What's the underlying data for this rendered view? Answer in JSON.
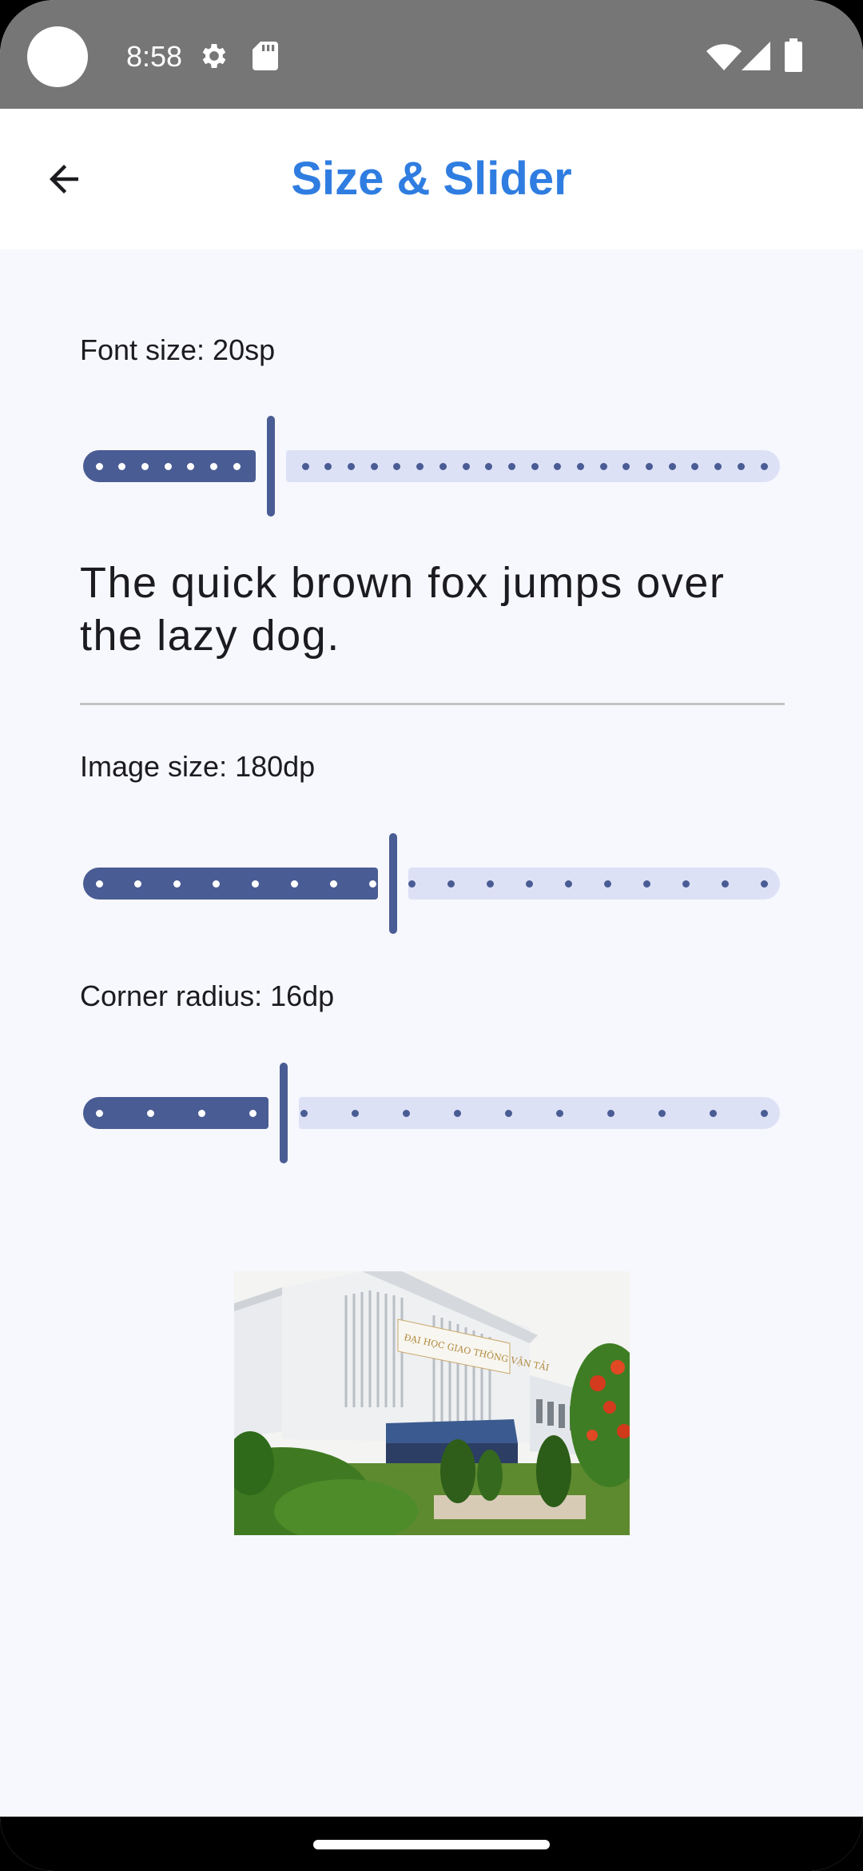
{
  "status_bar": {
    "time": "8:58",
    "icons": [
      "settings-gear-icon",
      "sd-card-icon",
      "wifi-icon",
      "signal-icon",
      "battery-icon"
    ]
  },
  "app_bar": {
    "title": "Size & Slider",
    "back_icon": "arrow-back-icon",
    "title_color": "#2f7de1"
  },
  "font_size": {
    "label": "Font size: 20sp",
    "sample_text": "The quick brown fox jumps over the lazy dog.",
    "slider": {
      "steps": 30,
      "position": 8
    }
  },
  "image_size": {
    "label": "Image size: 180dp",
    "slider": {
      "steps": 18,
      "position": 8
    }
  },
  "corner_radius": {
    "label": "Corner radius: 16dp",
    "slider": {
      "steps": 14,
      "position": 4
    }
  },
  "image": {
    "description_icon": "campus-building-photo",
    "sign_text": "ĐẠI HỌC GIAO THÔNG VẬN TẢI"
  },
  "colors": {
    "accent": "#4a5c94",
    "track_inactive": "#dde1f6",
    "background": "#f7f8fd"
  }
}
